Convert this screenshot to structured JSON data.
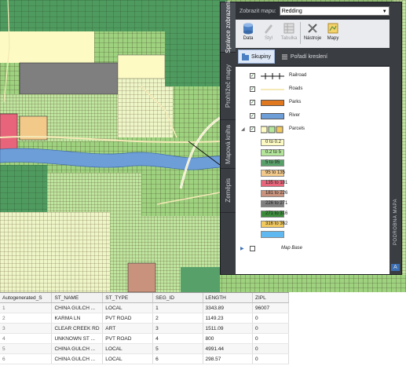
{
  "task_pane": {
    "side_tabs": [
      "Správce zobrazení",
      "Prohlížeč mapy",
      "Mapová kniha",
      "Zeměpis"
    ],
    "active_side_tab": "Správce zobrazení",
    "zoom_label": "Zobrazit mapu:",
    "zoom_value": "Redding",
    "toolbar": [
      {
        "label": "Data",
        "icon": "data-icon",
        "enabled": true
      },
      {
        "label": "Styl",
        "icon": "style-icon",
        "enabled": false
      },
      {
        "label": "Tabulka",
        "icon": "table-icon",
        "enabled": false
      },
      {
        "label": "Nástroje",
        "icon": "tools-icon",
        "enabled": true
      },
      {
        "label": "Mapy",
        "icon": "maps-icon",
        "enabled": true
      }
    ],
    "subbar": {
      "groups_label": "Skupiny",
      "order_label": "Pořadí kreslení"
    },
    "rail_title": "PODROBNÁ MAPA"
  },
  "legend": {
    "layers": [
      {
        "name": "Railroad",
        "symbol": "railroad",
        "checked": true
      },
      {
        "name": "Roads",
        "symbol": "line",
        "color": "#f5e9b8",
        "checked": true
      },
      {
        "name": "Parks",
        "symbol": "fill",
        "color": "#e07820",
        "checked": true
      },
      {
        "name": "River",
        "symbol": "fill",
        "color": "#6e9ed8",
        "checked": true
      },
      {
        "name": "Parcels",
        "symbol": "multi",
        "checked": true,
        "expanded": true
      }
    ],
    "parcel_classes": [
      {
        "label": "0 to 0.2",
        "color": "#fdfbc3"
      },
      {
        "label": "0.2 to 5",
        "color": "#b3e59a"
      },
      {
        "label": "5 to 95",
        "color": "#58a06a"
      },
      {
        "label": "95 to 135",
        "color": "#f3c98a"
      },
      {
        "label": "135 to 181",
        "color": "#e8647a"
      },
      {
        "label": "181 to 226",
        "color": "#c9927c"
      },
      {
        "label": "226 to 271",
        "color": "#7f7f7f"
      },
      {
        "label": "271 to 316",
        "color": "#3a8a3a"
      },
      {
        "label": "316 to 362",
        "color": "#f2c95e"
      },
      {
        "label": "",
        "color": "#5fb8f0"
      }
    ],
    "map_base": {
      "name": "Map Base",
      "checked": false,
      "expanded": false
    }
  },
  "attribute_table": {
    "columns": [
      "Autogenerated_S",
      "ST_NAME",
      "ST_TYPE",
      "SEG_ID",
      "LENGTH",
      "ZIPL"
    ],
    "rows": [
      [
        "1",
        "CHINA GULCH ...",
        "LOCAL",
        "1",
        "3343.89",
        "96007"
      ],
      [
        "2",
        "KARMA LN",
        "PVT ROAD",
        "2",
        "1149.23",
        "0"
      ],
      [
        "3",
        "CLEAR CREEK RD",
        "ART",
        "3",
        "1511.09",
        "0"
      ],
      [
        "4",
        "UNKNOWN ST ...",
        "PVT ROAD",
        "4",
        "800",
        "0"
      ],
      [
        "5",
        "CHINA GULCH ...",
        "LOCAL",
        "5",
        "4991.44",
        "0"
      ],
      [
        "6",
        "CHINA GULCH ...",
        "LOCAL",
        "6",
        "298.57",
        "0"
      ]
    ]
  }
}
